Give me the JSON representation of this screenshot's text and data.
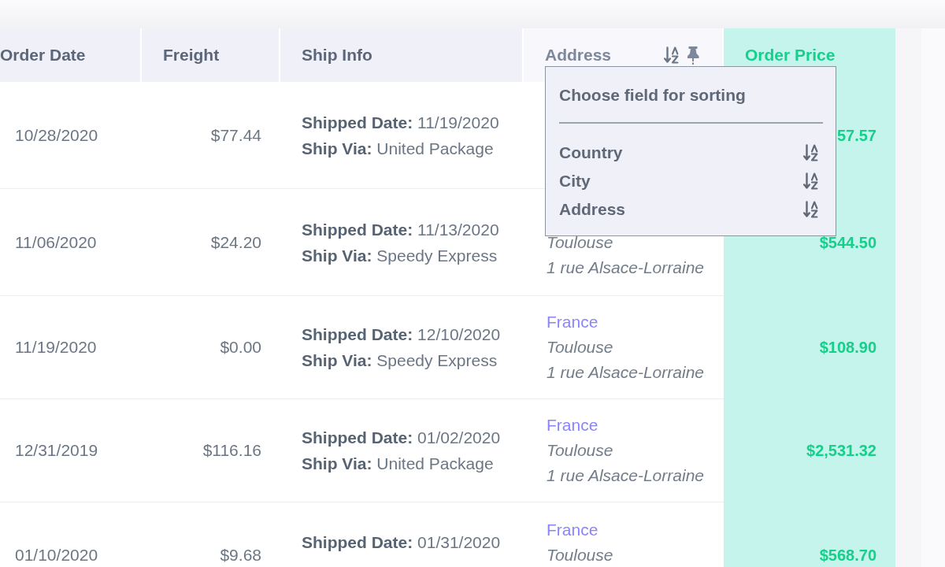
{
  "table": {
    "columns": [
      {
        "label": "Order Date",
        "kind": "date",
        "active": false,
        "highlighted": false
      },
      {
        "label": "Freight",
        "kind": "money",
        "active": false,
        "highlighted": false
      },
      {
        "label": "Ship Info",
        "kind": "ship",
        "active": false,
        "highlighted": false
      },
      {
        "label": "Address",
        "kind": "address",
        "active": true,
        "highlighted": false
      },
      {
        "label": "Order Price",
        "kind": "price",
        "active": false,
        "highlighted": true
      }
    ],
    "rows": [
      {
        "order_date": "10/28/2020",
        "freight": "$77.44",
        "ship_info": [
          "**Shipped Date:** 11/19/2020",
          "**Ship Via:** United Package"
        ],
        "order_price": "57.57"
      },
      {
        "order_date": "11/06/2020",
        "freight": "$24.20",
        "ship_info": [
          "**Shipped Date:** 11/13/2020",
          "**Ship Via:** Speedy Express"
        ],
        "address": {
          "city": "Toulouse",
          "street": "1 rue Alsace-Lorraine"
        },
        "order_price": "$544.50"
      },
      {
        "order_date": "11/19/2020",
        "freight": "$0.00",
        "ship_info": [
          "**Shipped Date:** 12/10/2020",
          "**Ship Via:** Speedy Express"
        ],
        "address": {
          "country": "France",
          "city": "Toulouse",
          "street": "1 rue Alsace-Lorraine"
        },
        "order_price": "$108.90"
      },
      {
        "order_date": "12/31/2019",
        "freight": "$116.16",
        "ship_info": [
          "**Shipped Date:** 01/02/2020",
          "**Ship Via:** United Package"
        ],
        "address": {
          "country": "France",
          "city": "Toulouse",
          "street": "1 rue Alsace-Lorraine"
        },
        "order_price": "$2,531.32"
      },
      {
        "order_date": "01/10/2020",
        "freight": "$9.68",
        "ship_info": [
          "**Shipped Date:** 01/31/2020"
        ],
        "address": {
          "country": "France",
          "city": "Toulouse"
        },
        "order_price": "$568.70"
      }
    ]
  },
  "sort_menu": {
    "title": "Choose field for sorting",
    "fields": [
      "Country",
      "City",
      "Address"
    ]
  }
}
